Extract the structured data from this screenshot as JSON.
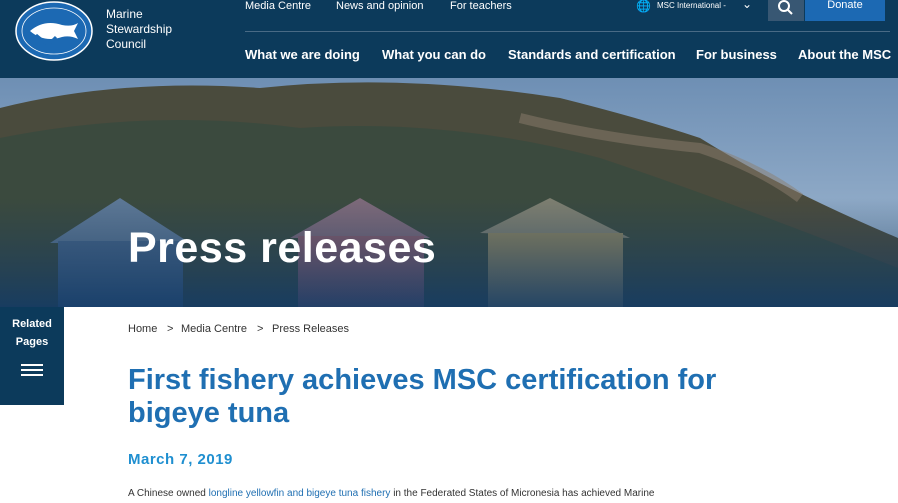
{
  "header": {
    "logo_lines": [
      "Marine",
      "Stewardship",
      "Council"
    ],
    "utility_links": [
      "Media Centre",
      "News and opinion",
      "For teachers"
    ],
    "language": "MSC International -",
    "donate_label": "Donate",
    "nav": [
      "What we are doing",
      "What you can do",
      "Standards and certification",
      "For business",
      "About the MSC"
    ]
  },
  "hero": {
    "title": "Press releases"
  },
  "related_pages": {
    "label_line1": "Related",
    "label_line2": "Pages"
  },
  "breadcrumb": {
    "items": [
      "Home",
      "Media Centre",
      "Press Releases"
    ],
    "separator": ">"
  },
  "article": {
    "headline": "First fishery achieves MSC certification for bigeye tuna",
    "date": "March 7, 2019",
    "intro_prefix": "A Chinese owned ",
    "intro_link": "longline yellowfin and bigeye tuna fishery",
    "intro_suffix": " in the Federated States of Micronesia has achieved Marine"
  },
  "colors": {
    "header_bg": "#0c3a5b",
    "donate_bg": "#1c69b3",
    "headline": "#1f6fb2",
    "date": "#1f8fd0"
  }
}
